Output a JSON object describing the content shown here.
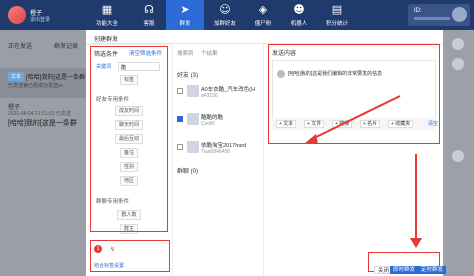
{
  "topbar": {
    "user_name": "橙子",
    "user_status": "退出登录",
    "nav": [
      {
        "label": "功能大全",
        "icon": "grid-icon"
      },
      {
        "label": "客服",
        "icon": "headset-icon"
      },
      {
        "label": "群发",
        "icon": "send-icon"
      },
      {
        "label": "加群好友",
        "icon": "add-friend-icon"
      },
      {
        "label": "僵尸粉",
        "icon": "ghost-icon"
      },
      {
        "label": "机器人",
        "icon": "robot-icon"
      },
      {
        "label": "积分统计",
        "icon": "chart-icon"
      }
    ],
    "account_id": "ID:"
  },
  "left_panel": {
    "tabs": [
      "正在发送",
      "群发记录"
    ],
    "row1": {
      "tag": "文本",
      "message": "[哈哈]我的[这是一条群",
      "count": "已发送第已经成功发送xx"
    },
    "row2": {
      "name": "橙子",
      "time": "2021-08-04 21:51:53 已发送",
      "message": "[哈哈]我的[这是一条群"
    }
  },
  "dialog": {
    "title": "创建群发",
    "filter": {
      "title": "筛选条件",
      "clear": "清空筛选条件",
      "keyword_label": "关键词",
      "keyword_value": "酷",
      "items": [
        {
          "text": "标签",
          "kind": "pill"
        },
        {
          "text": "好友专用条件",
          "kind": "sect"
        },
        {
          "text": "成友时间",
          "kind": "pill"
        },
        {
          "text": "聊天时间",
          "kind": "pill"
        },
        {
          "text": "最后互动",
          "kind": "pill"
        },
        {
          "text": "备注",
          "kind": "pill"
        },
        {
          "text": "性别",
          "kind": "pill"
        },
        {
          "text": "地区",
          "kind": "pill"
        },
        {
          "text": "群聊专用条件",
          "kind": "sect"
        },
        {
          "text": "群人数",
          "kind": "pill"
        },
        {
          "text": "群主",
          "kind": "pill"
        }
      ]
    },
    "notice": {
      "number": "1",
      "link": "结合标签设置"
    },
    "friends": {
      "search": "搜索到",
      "count": "个结果",
      "section_friend": "好友 (3)",
      "section_group": "群聊 (0)",
      "list": [
        {
          "name": "A0车衣酷_汽车改色(H",
          "sub": "a43156",
          "checked": false
        },
        {
          "name": "酷酷的酷",
          "sub": "CoolR",
          "checked": true
        },
        {
          "name": "依酷淘宝2017hard",
          "sub": "Tian0846456",
          "checked": false
        }
      ]
    },
    "compose": {
      "title": "发送内容",
      "text": "[哈哈]我的[这是我们编辑的非常要发的信息",
      "toolbar": [
        "+ 文本",
        "+ 文件",
        "+ 链接",
        "+ 名片",
        "+ 收藏夹"
      ],
      "clear": "清空"
    },
    "footer": {
      "close": "关闭",
      "send": "即时群发",
      "timer": "定时群发"
    }
  }
}
